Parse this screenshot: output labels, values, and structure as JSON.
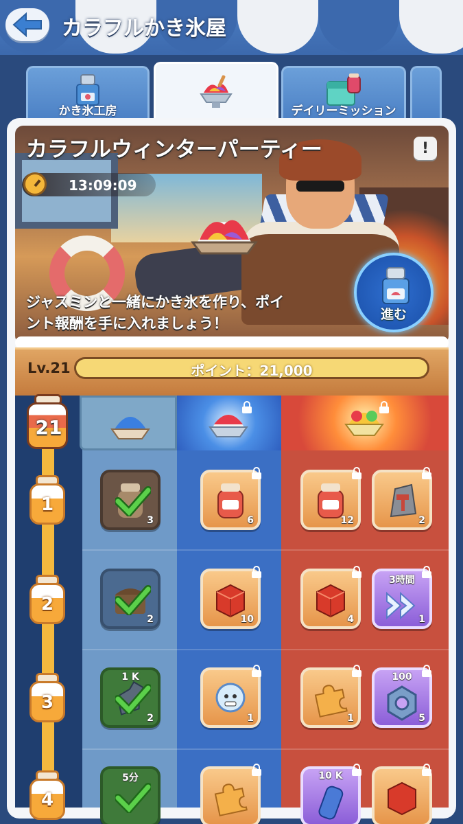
{
  "header": {
    "title": "カラフルかき氷屋"
  },
  "tabs": [
    {
      "label": "かき氷工房",
      "icon": "shaved-ice-machine-icon",
      "active": false
    },
    {
      "label": "",
      "icon": "shaved-ice-bowl-icon",
      "active": true
    },
    {
      "label": "デイリーミッション",
      "icon": "calendar-jam-icon",
      "active": false
    }
  ],
  "event": {
    "title": "カラフルウィンターパーティー",
    "timer": "13:09:09",
    "description_line1": "ジャスミンと一緒にかき氷を作り、ポイ",
    "description_line2": "ント報酬を手に入れましょう！",
    "go_label": "進む"
  },
  "level": {
    "label": "Lv.21",
    "points_text": "ポイント：21,000",
    "progress": 1.0
  },
  "current_level_jar": "21",
  "tiers": [
    {
      "name": "free",
      "icon": "blue-shaved-ice-icon",
      "locked": false
    },
    {
      "name": "premium",
      "icon": "strawberry-shaved-ice-icon",
      "locked": true
    },
    {
      "name": "deluxe",
      "icon": "fruit-parfait-ice-icon",
      "locked": true
    }
  ],
  "rows": [
    {
      "level": "1",
      "free": {
        "icon": "jam-jar-icon",
        "qty": "3",
        "claimed": true
      },
      "blue": {
        "icon": "jam-jar-icon",
        "qty": "6"
      },
      "red1": {
        "icon": "jam-jar-icon",
        "qty": "12"
      },
      "red2": {
        "icon": "hammer-stone-icon",
        "qty": "2"
      }
    },
    {
      "level": "2",
      "free": {
        "icon": "treasure-chest-icon",
        "qty": "2",
        "claimed": true
      },
      "blue": {
        "icon": "red-gem-cube-icon",
        "qty": "10"
      },
      "red1": {
        "icon": "red-gem-cube-icon",
        "qty": "4"
      },
      "red2": {
        "icon": "speed-up-icon",
        "qty": "1",
        "top": "3時間"
      }
    },
    {
      "level": "3",
      "free": {
        "icon": "potion-bottle-icon",
        "qty": "2",
        "claimed": true,
        "top": "1 K"
      },
      "blue": {
        "icon": "yeti-card-icon",
        "qty": "1"
      },
      "red1": {
        "icon": "puzzle-piece-icon",
        "qty": "1"
      },
      "red2": {
        "icon": "gear-nut-icon",
        "qty": "5",
        "top": "100"
      }
    },
    {
      "level": "4",
      "free": {
        "icon": "timer-skip-icon",
        "qty": "",
        "claimed": true,
        "top": "5分"
      },
      "blue": {
        "icon": "puzzle-piece-icon",
        "qty": ""
      },
      "red1": {
        "icon": "exp-potion-icon",
        "qty": "",
        "top": "10 K"
      },
      "red2": {
        "icon": "red-gem-cube-icon",
        "qty": ""
      }
    }
  ],
  "colors": {
    "header_blue": "#3c69ad",
    "free_col": "#6f9ac8",
    "blue_col": "#3b6fc4",
    "red_col": "#c8503e",
    "track": "#f5b93e"
  }
}
